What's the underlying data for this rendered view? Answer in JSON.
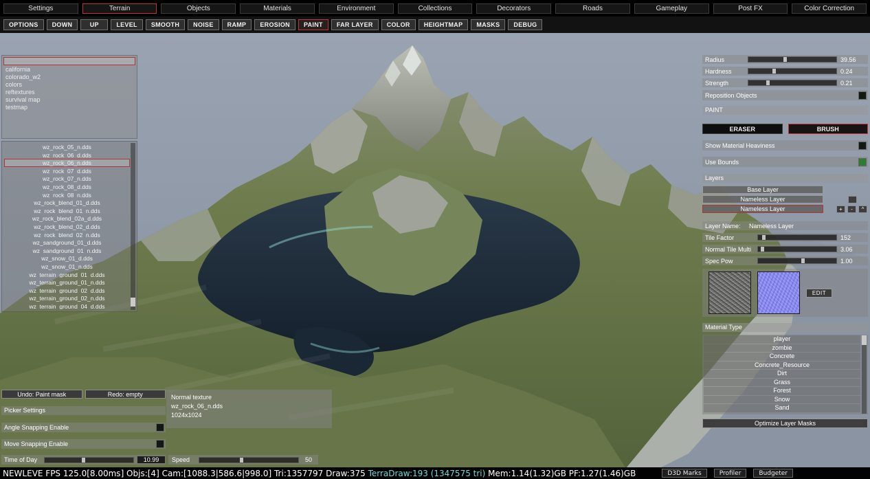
{
  "colors": {
    "accent_red": "#c03434",
    "status_cyan": "#6fd8d8",
    "checkbox_green": "#2e7d32"
  },
  "top_menu": {
    "items": [
      {
        "label": "Settings",
        "active": false
      },
      {
        "label": "Terrain",
        "active": true
      },
      {
        "label": "Objects",
        "active": false
      },
      {
        "label": "Materials",
        "active": false
      },
      {
        "label": "Environment",
        "active": false
      },
      {
        "label": "Collections",
        "active": false
      },
      {
        "label": "Decorators",
        "active": false
      },
      {
        "label": "Roads",
        "active": false
      },
      {
        "label": "Gameplay",
        "active": false
      },
      {
        "label": "Post FX",
        "active": false
      },
      {
        "label": "Color Correction",
        "active": false
      }
    ]
  },
  "terrain_toolbar": {
    "items": [
      {
        "label": "OPTIONS",
        "active": false
      },
      {
        "label": "DOWN",
        "active": false
      },
      {
        "label": "UP",
        "active": false
      },
      {
        "label": "LEVEL",
        "active": false
      },
      {
        "label": "SMOOTH",
        "active": false
      },
      {
        "label": "NOISE",
        "active": false
      },
      {
        "label": "RAMP",
        "active": false
      },
      {
        "label": "EROSION",
        "active": false
      },
      {
        "label": "PAINT",
        "active": true
      },
      {
        "label": "FAR LAYER",
        "active": false
      },
      {
        "label": "COLOR",
        "active": false
      },
      {
        "label": "HEIGHTMAP",
        "active": false
      },
      {
        "label": "MASKS",
        "active": false
      },
      {
        "label": "DEBUG",
        "active": false
      }
    ]
  },
  "map_panel": {
    "header": "",
    "items": [
      "california",
      "colorado_w2",
      "colors",
      "reftextures",
      "survival map",
      "testmap"
    ]
  },
  "texture_panel": {
    "items": [
      {
        "label": "wz_rock_05_n.dds",
        "selected": false
      },
      {
        "label": "wz_rock_06_d.dds",
        "selected": false
      },
      {
        "label": "wz_rock_06_n.dds",
        "selected": true
      },
      {
        "label": "wz_rock_07_d.dds",
        "selected": false
      },
      {
        "label": "wz_rock_07_n.dds",
        "selected": false
      },
      {
        "label": "wz_rock_08_d.dds",
        "selected": false
      },
      {
        "label": "wz_rock_08_n.dds",
        "selected": false
      },
      {
        "label": "wz_rock_blend_01_d.dds",
        "selected": false
      },
      {
        "label": "wz_rock_blend_01_n.dds",
        "selected": false
      },
      {
        "label": "wz_rock_blend_02a_d.dds",
        "selected": false
      },
      {
        "label": "wz_rock_blend_02_d.dds",
        "selected": false
      },
      {
        "label": "wz_rock_blend_02_n.dds",
        "selected": false
      },
      {
        "label": "wz_sandground_01_d.dds",
        "selected": false
      },
      {
        "label": "wz_sandground_01_n.dds",
        "selected": false
      },
      {
        "label": "wz_snow_01_d.dds",
        "selected": false
      },
      {
        "label": "wz_snow_01_n.dds",
        "selected": false
      },
      {
        "label": "wz_terrain_ground_01_d.dds",
        "selected": false
      },
      {
        "label": "wz_terrain_ground_01_n.dds",
        "selected": false
      },
      {
        "label": "wz_terrain_ground_02_d.dds",
        "selected": false
      },
      {
        "label": "wz_terrain_ground_02_n.dds",
        "selected": false
      },
      {
        "label": "wz_terrain_ground_04_d.dds",
        "selected": false
      }
    ]
  },
  "brush_panel": {
    "sliders": [
      {
        "label": "Radius",
        "value": "39.56",
        "pos": 0.42
      },
      {
        "label": "Hardness",
        "value": "0.24",
        "pos": 0.3
      },
      {
        "label": "Strength",
        "value": "0.21",
        "pos": 0.23
      }
    ],
    "reposition": {
      "label": "Reposition Objects",
      "checked": false
    },
    "paint_section_label": "PAINT",
    "eraser_label": "ERASER",
    "brush_label": "BRUSH",
    "show_material_heaviness": {
      "label": "Show Material Heaviness",
      "checked": false
    },
    "use_bounds": {
      "label": "Use Bounds",
      "checked": true
    }
  },
  "layers_panel": {
    "section_label": "Layers",
    "layers": [
      {
        "label": "Base Layer",
        "selected": false
      },
      {
        "label": "Nameless Layer",
        "selected": false
      },
      {
        "label": "Nameless Layer",
        "selected": true
      }
    ],
    "mini_single_label": "",
    "mini_buttons": [
      "+",
      "-",
      "^"
    ],
    "layer_name_label": "Layer Name:",
    "layer_name_value": "Nameless Layer",
    "sliders": [
      {
        "label": "Tile Factor",
        "value": "152",
        "pos": 0.08
      },
      {
        "label": "Normal Tile Multi",
        "value": "3.06",
        "pos": 0.06
      },
      {
        "label": "Spec Pow",
        "value": "1.00",
        "pos": 0.58
      }
    ],
    "edit_button_label": "EDIT",
    "material_type_label": "Material Type",
    "materials": [
      "player",
      "zombie",
      "Concrete",
      "Concrete_Resource",
      "Dirt",
      "Grass",
      "Forest",
      "Snow",
      "Sand"
    ],
    "optimize_button_label": "Optimize Layer Masks"
  },
  "bottom_panel": {
    "undo_label": "Undo: Paint mask",
    "redo_label": "Redo: empty",
    "picker_settings_label": "Picker Settings",
    "angle_snapping": {
      "label": "Angle Snapping Enable",
      "checked": false
    },
    "move_snapping": {
      "label": "Move Snapping Enable",
      "checked": false
    },
    "time_of_day": {
      "label": "Time of Day",
      "value": "10.99",
      "pos": 0.44
    },
    "speed": {
      "label": "Speed",
      "value": "50",
      "pos": 0.43
    }
  },
  "texture_tooltip": {
    "type_label": "Normal texture",
    "file_name": "wz_rock_06_n.dds",
    "resolution": "1024x1024"
  },
  "status_bar": {
    "segments": [
      {
        "text": "NEWLEVE FPS 125.0[8.00ms] Objs:[4] Cam:[1088.3|586.6|998.0] Tri:1357797 Draw:375 ",
        "color": "#ffffff"
      },
      {
        "text": "TerraDraw:193 (1347575 tri) ",
        "color": "#6fd8d8"
      },
      {
        "text": "Mem:1.14(1.32)GB PF:1.27(1.46)GB",
        "color": "#ffffff"
      }
    ],
    "buttons": [
      "D3D Marks",
      "Profiler",
      "Budgeter"
    ]
  }
}
